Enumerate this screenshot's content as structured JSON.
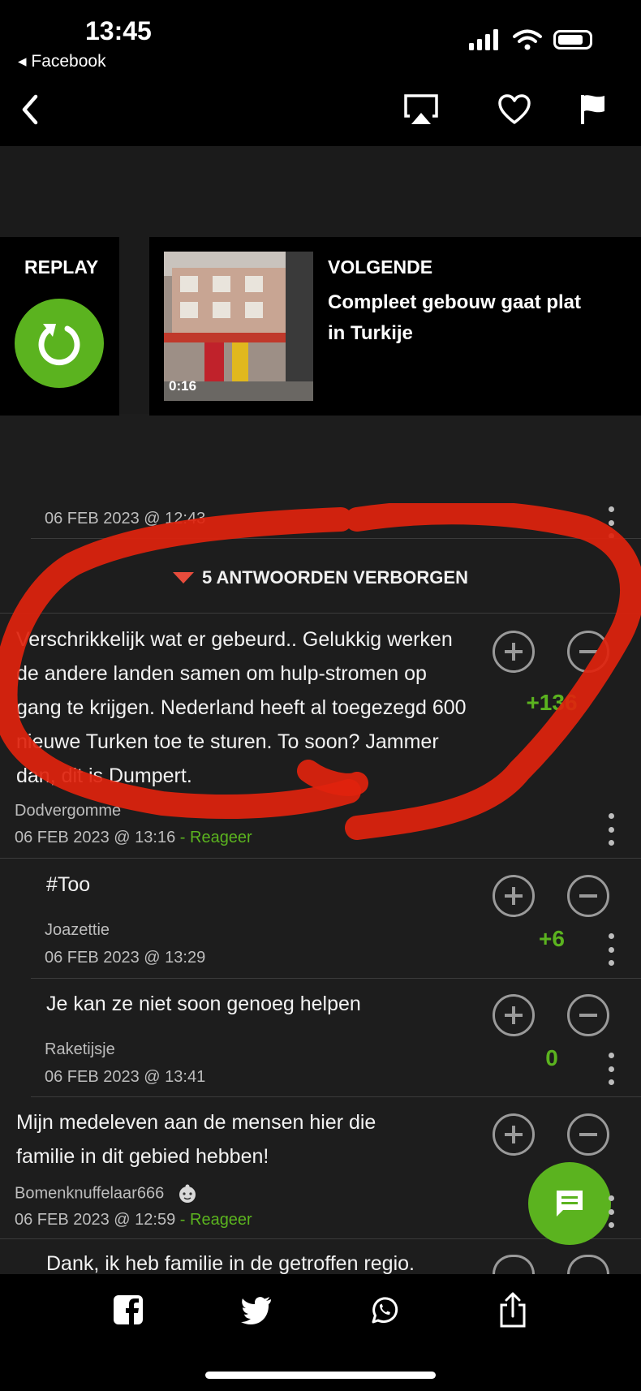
{
  "status_bar": {
    "time": "13:45",
    "back_app": "◂ Facebook"
  },
  "nav": {
    "icons": [
      "back-arrow-icon",
      "airplay-icon",
      "heart-icon",
      "flag-icon"
    ]
  },
  "replay": {
    "label": "REPLAY"
  },
  "next_video": {
    "label": "VOLGENDE",
    "title": "Compleet gebouw gaat plat in Turkije",
    "duration": "0:16"
  },
  "top_comment_meta": {
    "date": "06 FEB 2023 @ 12:43"
  },
  "hidden_replies": {
    "label": "5 ANTWOORDEN VERBORGEN"
  },
  "comments": [
    {
      "text": "Verschrikkelijk wat er gebeurd.. Gelukkig werken de andere landen samen om hulp-stromen op gang te krijgen. Nederland heeft al toegezegd 600 nieuwe Turken toe te sturen. To soon? Jammer dan, dit is Dumpert.",
      "author": "Dodvergomme",
      "date": "06 FEB 2023 @ 13:16",
      "reply": "- Reageer",
      "score": "+136"
    },
    {
      "text": "#Too",
      "author": "Joazettie",
      "date": "06 FEB 2023 @ 13:29",
      "score": "+6"
    },
    {
      "text": "Je kan ze niet soon genoeg helpen",
      "author": "Raketijsje",
      "date": "06 FEB 2023 @ 13:41",
      "score": "0"
    },
    {
      "text": "Mijn medeleven aan de mensen hier die familie in dit gebied hebben!",
      "author": "Bomenknuffelaar666",
      "date": "06 FEB 2023 @ 12:59",
      "reply": "- Reageer"
    },
    {
      "text": "Dank, ik heb familie in de getroffen regio."
    }
  ],
  "share_bar": {
    "icons": [
      "facebook-icon",
      "twitter-icon",
      "whatsapp-icon",
      "share-icon"
    ]
  },
  "colors": {
    "accent": "#5bb31f",
    "background": "#1d1d1d",
    "annotation": "#e0230d"
  }
}
